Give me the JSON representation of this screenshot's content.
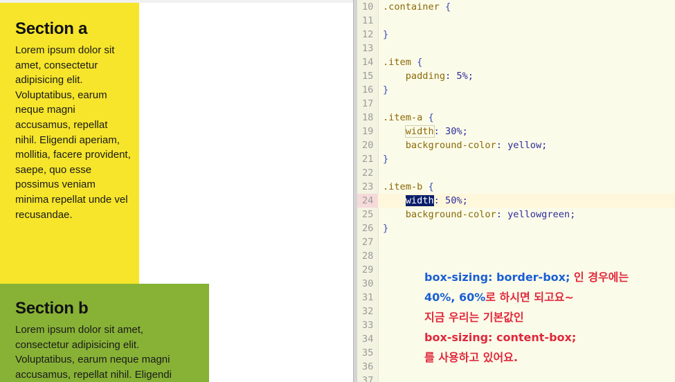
{
  "preview": {
    "section_a": {
      "title": "Section a",
      "body": "Lorem ipsum dolor sit amet, consectetur adipisicing elit. Voluptatibus, earum neque magni accusamus, repellat nihil. Eligendi aperiam, mollitia, facere provident, saepe, quo esse possimus veniam minima repellat unde vel recusandae.",
      "background": "#f6e52a"
    },
    "section_b": {
      "title": "Section b",
      "body": "Lorem ipsum dolor sit amet, consectetur adipisicing elit. Voluptatibus, earum neque magni accusamus, repellat nihil. Eligendi",
      "background": "#88b236"
    }
  },
  "editor": {
    "current_line": 24,
    "lines": [
      {
        "n": "10",
        "code": ".container {"
      },
      {
        "n": "11",
        "code": ""
      },
      {
        "n": "12",
        "code": "}"
      },
      {
        "n": "13",
        "code": ""
      },
      {
        "n": "14",
        "code": ".item {"
      },
      {
        "n": "15",
        "code": "    padding: 5%;"
      },
      {
        "n": "16",
        "code": "}"
      },
      {
        "n": "17",
        "code": ""
      },
      {
        "n": "18",
        "code": ".item-a {"
      },
      {
        "n": "19",
        "code": "    width: 30%;"
      },
      {
        "n": "20",
        "code": "    background-color: yellow;"
      },
      {
        "n": "21",
        "code": "}"
      },
      {
        "n": "22",
        "code": ""
      },
      {
        "n": "23",
        "code": ".item-b {"
      },
      {
        "n": "24",
        "code": "    width: 50%;"
      },
      {
        "n": "25",
        "code": "    background-color: yellowgreen;"
      },
      {
        "n": "26",
        "code": "}"
      },
      {
        "n": "27",
        "code": ""
      },
      {
        "n": "28",
        "code": ""
      },
      {
        "n": "29",
        "code": ""
      },
      {
        "n": "30",
        "code": ""
      },
      {
        "n": "31",
        "code": ""
      },
      {
        "n": "32",
        "code": ""
      },
      {
        "n": "33",
        "code": ""
      },
      {
        "n": "34",
        "code": ""
      },
      {
        "n": "35",
        "code": ""
      },
      {
        "n": "36",
        "code": ""
      },
      {
        "n": "37",
        "code": ""
      }
    ]
  },
  "annotation": {
    "line1_blue": "box-sizing: border-box;",
    "line1_red": " 인 경우에는",
    "line2_blue": "40%, 60%",
    "line2_red": "로 하시면 되고요~",
    "line3_red": "지금 우리는 기본값인",
    "line4_red": "box-sizing: content-box;",
    "line5_red": "를 사용하고 있어요."
  },
  "colors": {
    "editor_bg": "#fbfbe9",
    "selector": "#8a6a08",
    "brace": "#3a4fb8",
    "value": "#2c2c9e",
    "highlight": "#0a1e6a",
    "annotation_blue": "#1a5fd6",
    "annotation_red": "#e0283c"
  }
}
